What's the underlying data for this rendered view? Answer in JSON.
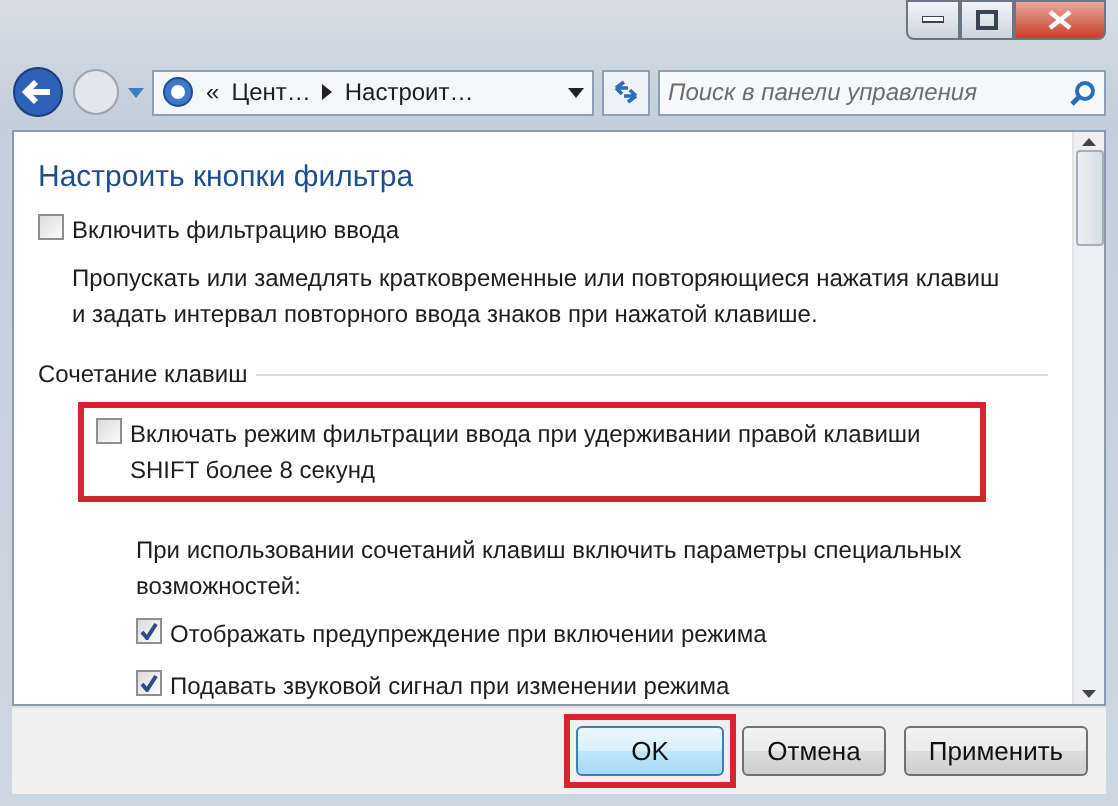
{
  "address_bar": {
    "prefix": "«",
    "segments": [
      "Цент…",
      "Настроит…"
    ]
  },
  "search": {
    "placeholder": "Поиск в панели управления"
  },
  "heading": "Настроить кнопки фильтра",
  "main_option": {
    "label": "Включить фильтрацию ввода",
    "checked": false
  },
  "description": "Пропускать или замедлять кратковременные или повторяющиеся нажатия клавиш и задать интервал повторного ввода знаков при нажатой клавише.",
  "shortcut_section": {
    "title": "Сочетание клавиш",
    "shortcut_option": {
      "label": "Включать режим фильтрации ввода при удерживании правой клавиши SHIFT более 8 секунд",
      "checked": false,
      "highlighted": true
    },
    "note": "При использовании сочетаний клавиш включить параметры специальных возможностей:",
    "options": [
      {
        "label": "Отображать предупреждение при включении режима",
        "checked": true
      },
      {
        "label": "Подавать звуковой сигнал при изменении режима",
        "checked": true
      }
    ]
  },
  "buttons": [
    {
      "label": "OK",
      "kind": "default",
      "highlighted": true
    },
    {
      "label": "Отмена",
      "kind": "normal",
      "highlighted": false
    },
    {
      "label": "Применить",
      "kind": "normal",
      "highlighted": false
    }
  ]
}
